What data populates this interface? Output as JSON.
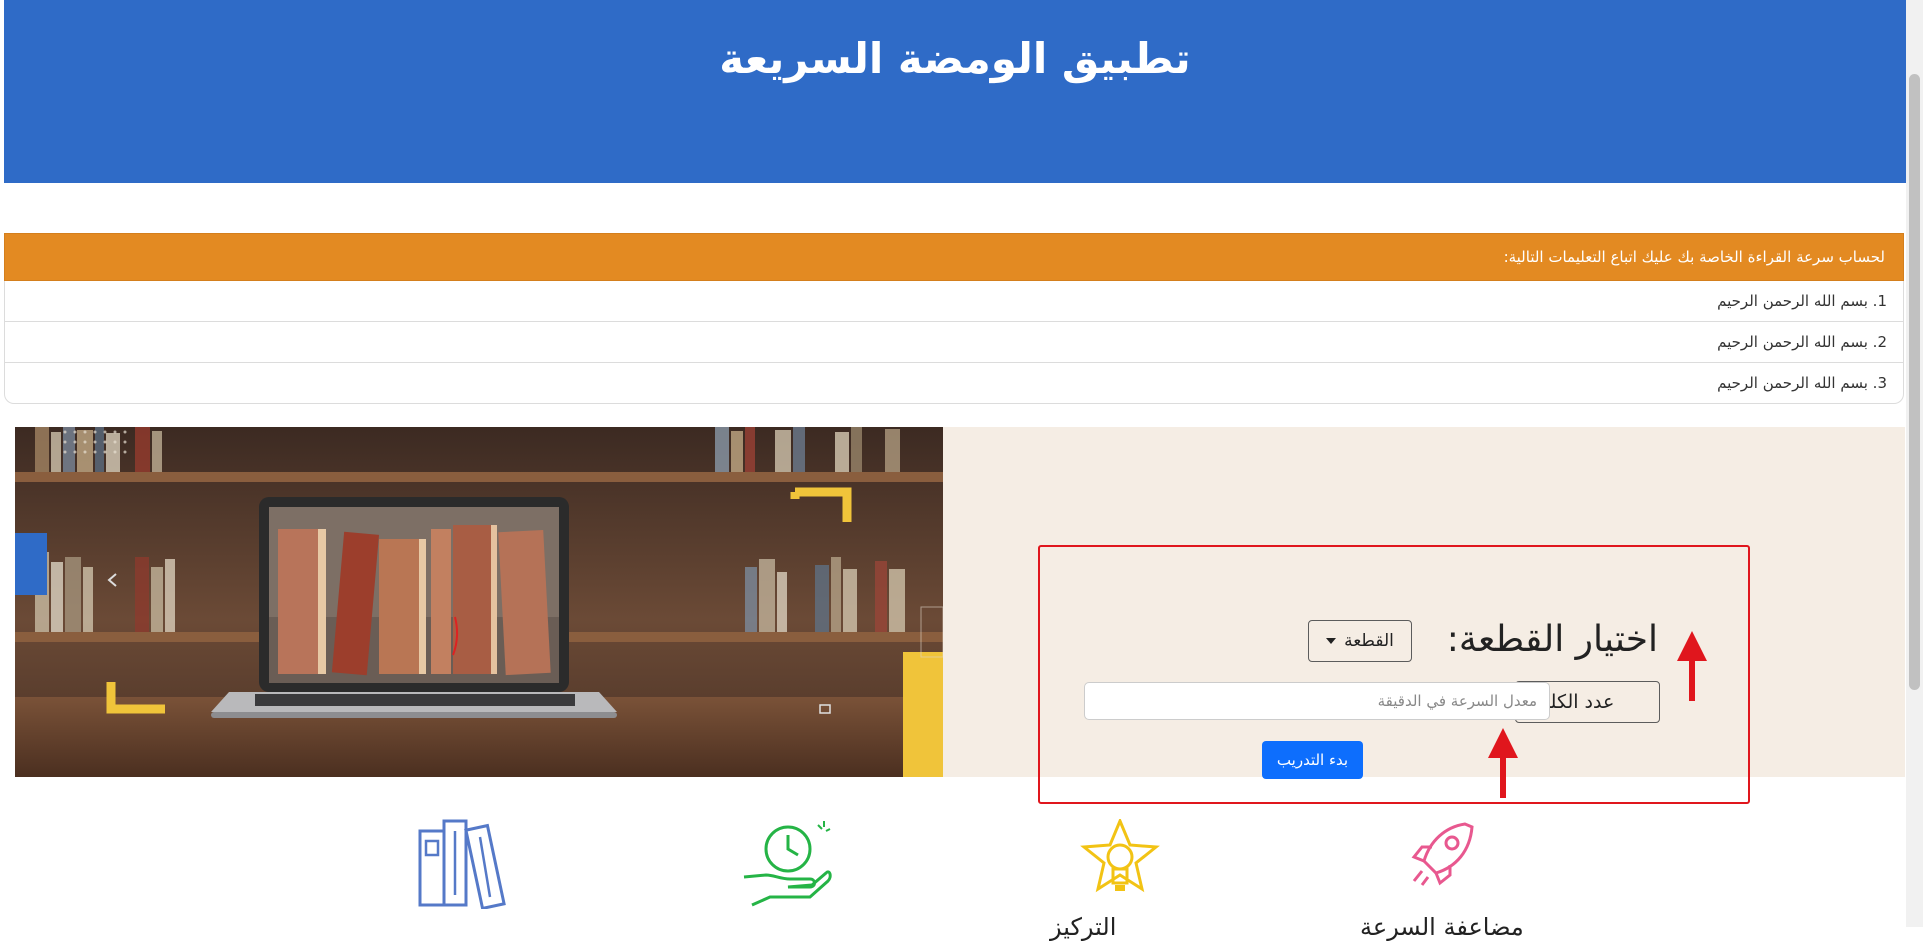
{
  "header": {
    "title": "تطبيق الومضة السريعة"
  },
  "alert": {
    "text": "لحساب سرعة القراءة الخاصة بك عليك اتباع التعليمات التالية:"
  },
  "steps": [
    "1. بسم الله الرحمن الرحيم",
    "2. بسم الله الرحمن الرحيم",
    "3. بسم الله الرحمن الرحيم"
  ],
  "form": {
    "passage_label": "اختيار القطعة:",
    "passage_select": "القطعة",
    "word_count_label": "عدد الكلمات",
    "rate_placeholder": "معدل السرعة في الدقيقة",
    "start_button": "بدء التدريب"
  },
  "features": [
    {
      "icon": "rocket-icon",
      "label": "مضاعفة السرعة",
      "color": "#e8588f"
    },
    {
      "icon": "lightbulb-star-icon",
      "label": "التركيز",
      "color": "#f2c314"
    },
    {
      "icon": "time-in-hand-icon",
      "label": "",
      "color": "#25b446"
    },
    {
      "icon": "books-icon",
      "label": "",
      "color": "#5579c8"
    }
  ],
  "colors": {
    "header": "#2f6bc7",
    "alert": "#e38a22",
    "banner_bg": "#f5ede4",
    "highlight": "#e0161d",
    "primary_button": "#0d6efd"
  }
}
